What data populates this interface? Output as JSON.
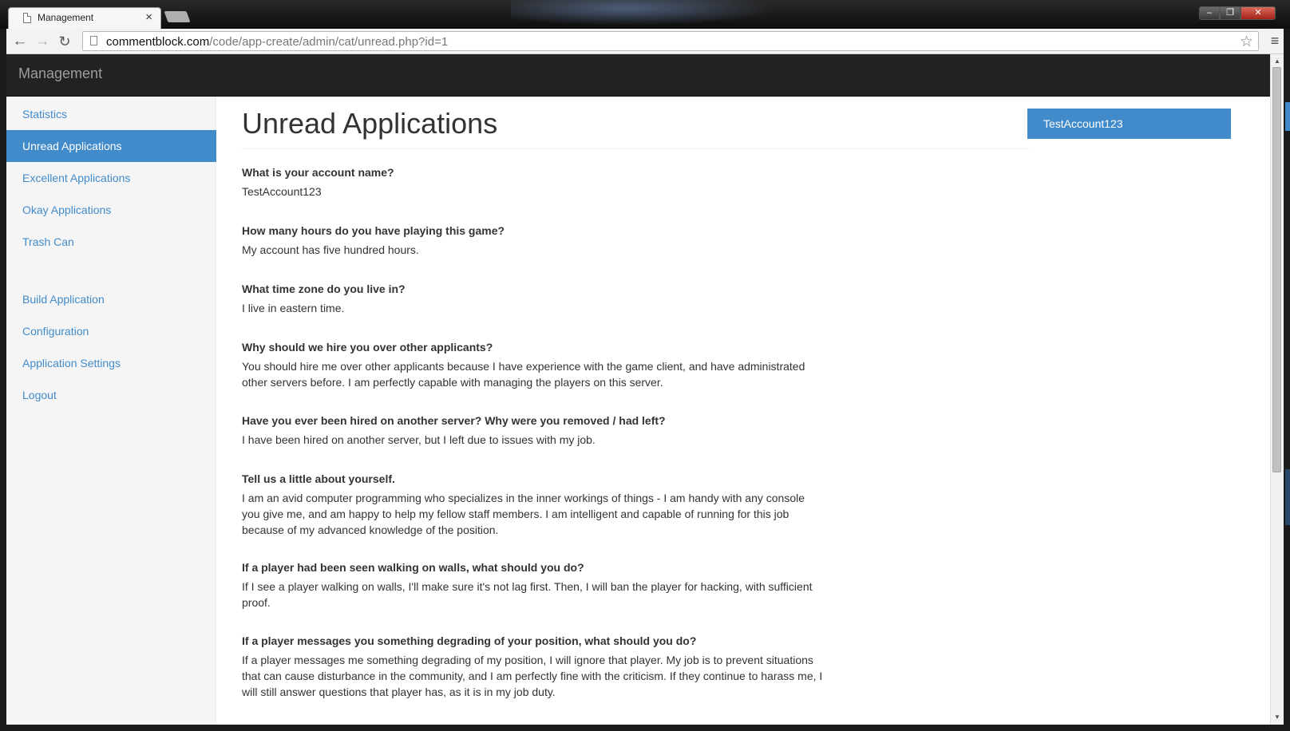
{
  "browser": {
    "tab_title": "Management",
    "tab_close": "×",
    "url_host": "commentblock.com",
    "url_path": "/code/app-create/admin/cat/unread.php?id=1",
    "window_controls": {
      "minimize": "‒",
      "maximize": "❐",
      "close": "✕"
    },
    "icons": {
      "back": "←",
      "forward": "→",
      "reload": "↻",
      "star": "☆",
      "menu": "≡"
    }
  },
  "navbar": {
    "brand": "Management"
  },
  "sidebar": {
    "main_items": [
      {
        "label": "Statistics"
      },
      {
        "label": "Unread Applications",
        "active": true
      },
      {
        "label": "Excellent Applications"
      },
      {
        "label": "Okay Applications"
      },
      {
        "label": "Trash Can"
      }
    ],
    "tool_items": [
      {
        "label": "Build Application"
      },
      {
        "label": "Configuration"
      },
      {
        "label": "Application Settings"
      },
      {
        "label": "Logout"
      }
    ]
  },
  "main": {
    "title": "Unread Applications",
    "qa": [
      {
        "q": "What is your account name?",
        "a": "TestAccount123"
      },
      {
        "q": "How many hours do you have playing this game?",
        "a": "My account has five hundred hours."
      },
      {
        "q": "What time zone do you live in?",
        "a": "I live in eastern time."
      },
      {
        "q": "Why should we hire you over other applicants?",
        "a": "You should hire me over other applicants because I have experience with the game client, and have administrated other servers before. I am perfectly capable with managing the players on this server."
      },
      {
        "q": "Have you ever been hired on another server? Why were you removed / had left?",
        "a": "I have been hired on another server, but I left due to issues with my job."
      },
      {
        "q": "Tell us a little about yourself.",
        "a": "I am an avid computer programming who specializes in the inner workings of things - I am handy with any console you give me, and am happy to help my fellow staff members. I am intelligent and capable of running for this job because of my advanced knowledge of the position."
      },
      {
        "q": "If a player had been seen walking on walls, what should you do?",
        "a": "If I see a player walking on walls, I'll make sure it's not lag first. Then, I will ban the player for hacking, with sufficient proof."
      },
      {
        "q": "If a player messages you something degrading of your position, what should you do?",
        "a": "If a player messages me something degrading of my position, I will ignore that player. My job is to prevent situations that can cause disturbance in the community, and I am perfectly fine with the criticism. If they continue to harass me, I will still answer questions that player has, as it is in my job duty."
      }
    ]
  },
  "applicants": {
    "items": [
      {
        "label": "TestAccount123",
        "active": true
      }
    ]
  },
  "colors": {
    "accent": "#428bca",
    "navbar_bg": "#222222",
    "sidebar_bg": "#f5f5f5",
    "text": "#333333"
  }
}
